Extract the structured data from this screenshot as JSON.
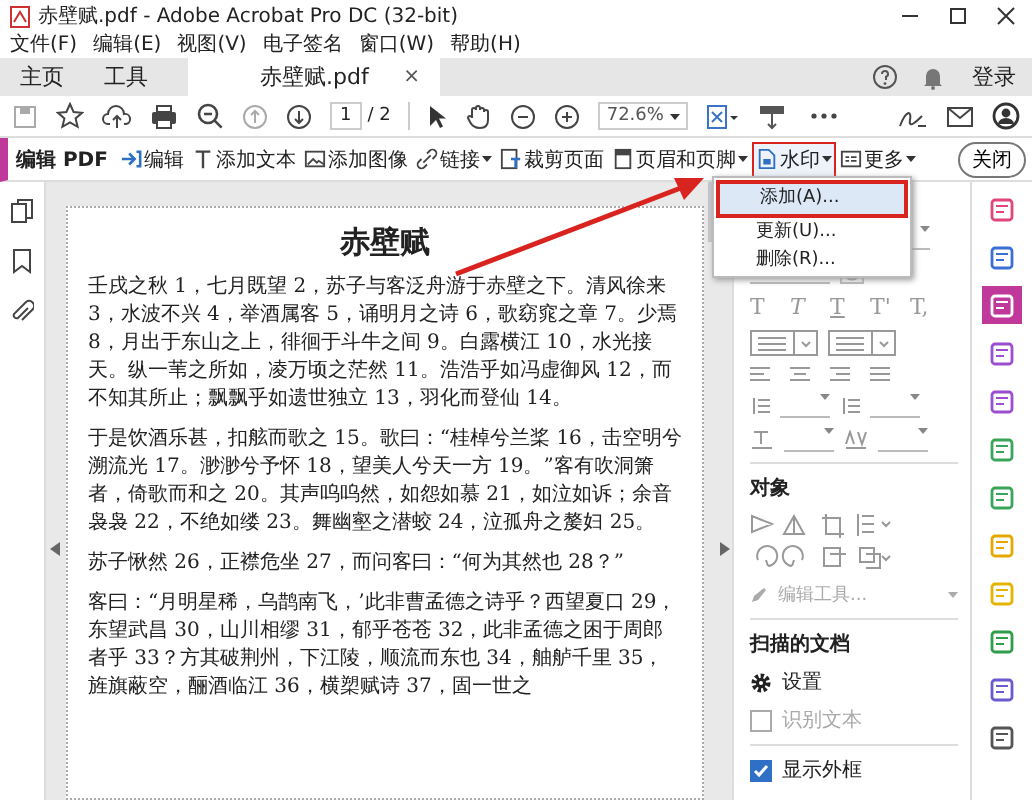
{
  "window": {
    "title": "赤壁赋.pdf - Adobe Acrobat Pro DC (32-bit)"
  },
  "menu": [
    "文件(F)",
    "编辑(E)",
    "视图(V)",
    "电子签名",
    "窗口(W)",
    "帮助(H)"
  ],
  "tabs": [
    {
      "label": "主页",
      "selected": false
    },
    {
      "label": "工具",
      "selected": false
    },
    {
      "label": "赤壁赋.pdf",
      "selected": true,
      "close": "×"
    }
  ],
  "sign_in": "登录",
  "page_nav": {
    "current": "1",
    "total": "/ 2"
  },
  "zoom": "72.6%",
  "edit_toolbar": {
    "title": "编辑 PDF",
    "close": "关闭",
    "tools": [
      {
        "label": "编辑",
        "dropdown": false,
        "selected": false
      },
      {
        "label": "添加文本",
        "dropdown": false,
        "selected": false
      },
      {
        "label": "添加图像",
        "dropdown": false,
        "selected": false
      },
      {
        "label": "链接",
        "dropdown": true,
        "selected": false
      },
      {
        "label": "裁剪页面",
        "dropdown": false,
        "selected": false
      },
      {
        "label": "页眉和页脚",
        "dropdown": true,
        "selected": false
      },
      {
        "label": "水印",
        "dropdown": true,
        "selected": true
      },
      {
        "label": "更多",
        "dropdown": true,
        "selected": false
      }
    ]
  },
  "watermark_menu": [
    {
      "label": "添加(A)...",
      "selected": true
    },
    {
      "label": "更新(U)...",
      "selected": false
    },
    {
      "label": "删除(R)...",
      "selected": false
    }
  ],
  "document": {
    "title": "赤壁赋",
    "paragraphs": [
      "壬戌之秋 1，七月既望 2，苏子与客泛舟游于赤壁之下。清风徐来 3，水波不兴 4，举酒属客 5，诵明月之诗 6，歌窈窕之章 7。少焉 8，月出于东山之上，徘徊于斗牛之间 9。白露横江 10，水光接天。纵一苇之所如，凌万顷之茫然 11。浩浩乎如冯虚御风 12，而不知其所止；飘飘乎如遗世独立 13，羽化而登仙 14。",
      "于是饮酒乐甚，扣舷而歌之 15。歌曰：“桂棹兮兰桨 16，击空明兮溯流光 17。渺渺兮予怀 18，望美人兮天一方 19。”客有吹洞箫者，倚歌而和之 20。其声呜呜然，如怨如慕 21，如泣如诉；余音袅袅 22，不绝如缕 23。舞幽壑之潜蛟 24，泣孤舟之嫠妇 25。",
      "苏子愀然 26，正襟危坐 27，而问客曰：“何为其然也 28？”",
      "客曰：“月明星稀，乌鹊南飞，’此非曹孟德之诗乎？西望夏口 29，东望武昌 30，山川相缪 31，郁乎苍苍 32，此非孟德之困于周郎者乎 33？方其破荆州，下江陵，顺流而东也 34，舳舻千里 35，旌旗蔽空，酾酒临江 36，横槊赋诗 37，固一世之"
    ]
  },
  "format_panel": {
    "text_styles": [
      "T",
      "T",
      "T",
      "T'",
      "T,"
    ],
    "object_heading": "对象",
    "edit_tool": "编辑工具...",
    "scan_heading": "扫描的文档",
    "settings": "设置",
    "checkboxes": [
      {
        "label": "识别文本",
        "checked": false,
        "disabled": true
      },
      {
        "label": "显示外框",
        "checked": true,
        "disabled": false
      }
    ]
  },
  "right_tools": [
    {
      "color": "#e0457b",
      "selected": false
    },
    {
      "color": "#3b6fd6",
      "selected": false
    },
    {
      "color": "#c0399a",
      "selected": true
    },
    {
      "color": "#9b4fd0",
      "selected": false
    },
    {
      "color": "#9b4fd0",
      "selected": false
    },
    {
      "color": "#3aa55a",
      "selected": false
    },
    {
      "color": "#3aa55a",
      "selected": false
    },
    {
      "color": "#e5a800",
      "selected": false
    },
    {
      "color": "#e5b400",
      "selected": false
    },
    {
      "color": "#2e9e4a",
      "selected": false
    },
    {
      "color": "#6a5acd",
      "selected": false
    },
    {
      "color": "#555555",
      "selected": false
    }
  ]
}
